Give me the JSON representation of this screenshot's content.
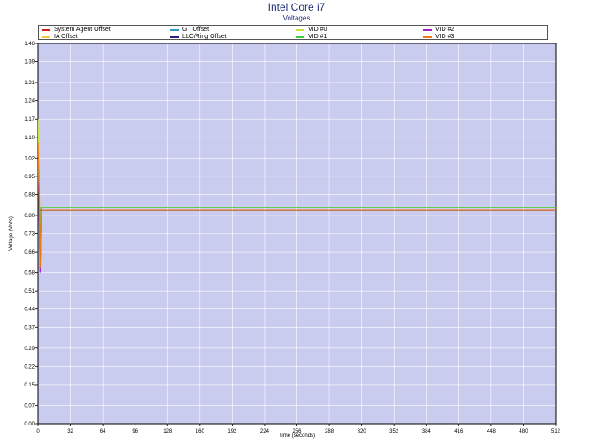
{
  "chart_data": {
    "type": "line",
    "title": "Intel Core i7",
    "subtitle": "Voltages",
    "xlabel": "Time (seconds)",
    "ylabel": "Voltage (Volts)",
    "xlim": [
      0,
      512
    ],
    "ylim": [
      0,
      1.46
    ],
    "xticks": [
      0,
      32,
      64,
      96,
      128,
      160,
      192,
      224,
      256,
      288,
      320,
      352,
      384,
      416,
      448,
      480,
      512
    ],
    "yticks": [
      "0.00",
      "0.07",
      "0.15",
      "0.22",
      "0.29",
      "0.37",
      "0.44",
      "0.51",
      "0.58",
      "0.66",
      "0.73",
      "0.80",
      "0.88",
      "0.95",
      "1.02",
      "1.10",
      "1.17",
      "1.24",
      "1.31",
      "1.39",
      "1.46"
    ],
    "grid": true,
    "legend_position": "top",
    "background": "#c9cbef",
    "series": [
      {
        "name": "System Agent Offset",
        "color": "#d11f1f",
        "x": [
          0,
          1,
          2,
          3,
          4,
          512
        ],
        "values": [
          1.1,
          0.95,
          0.6,
          0.82,
          0.82,
          0.82
        ]
      },
      {
        "name": "GT Offset",
        "color": "#2c9cc6",
        "x": [
          0,
          512
        ],
        "values": [
          0.82,
          0.82
        ]
      },
      {
        "name": "VID #0",
        "color": "#c8e03a",
        "x": [
          0,
          1,
          2,
          3,
          4,
          512
        ],
        "values": [
          1.17,
          1.0,
          0.65,
          0.83,
          0.83,
          0.83
        ]
      },
      {
        "name": "VID #2",
        "color": "#a01ec8",
        "x": [
          0,
          1,
          2,
          3,
          4,
          512
        ],
        "values": [
          1.02,
          0.85,
          0.58,
          0.82,
          0.82,
          0.82
        ]
      },
      {
        "name": "IA Offset",
        "color": "#f4c542",
        "x": [
          0,
          512
        ],
        "values": [
          0.82,
          0.82
        ]
      },
      {
        "name": "LLC/Ring Offset",
        "color": "#2a1f8a",
        "x": [
          0,
          512
        ],
        "values": [
          0.82,
          0.82
        ]
      },
      {
        "name": "VID #1",
        "color": "#3ccc3c",
        "x": [
          0,
          1,
          2,
          3,
          4,
          512
        ],
        "values": [
          1.05,
          0.9,
          0.62,
          0.83,
          0.83,
          0.83
        ]
      },
      {
        "name": "VID #3",
        "color": "#f07a12",
        "x": [
          0,
          1,
          2,
          3,
          4,
          512
        ],
        "values": [
          1.08,
          0.92,
          0.6,
          0.82,
          0.82,
          0.82
        ]
      }
    ]
  }
}
